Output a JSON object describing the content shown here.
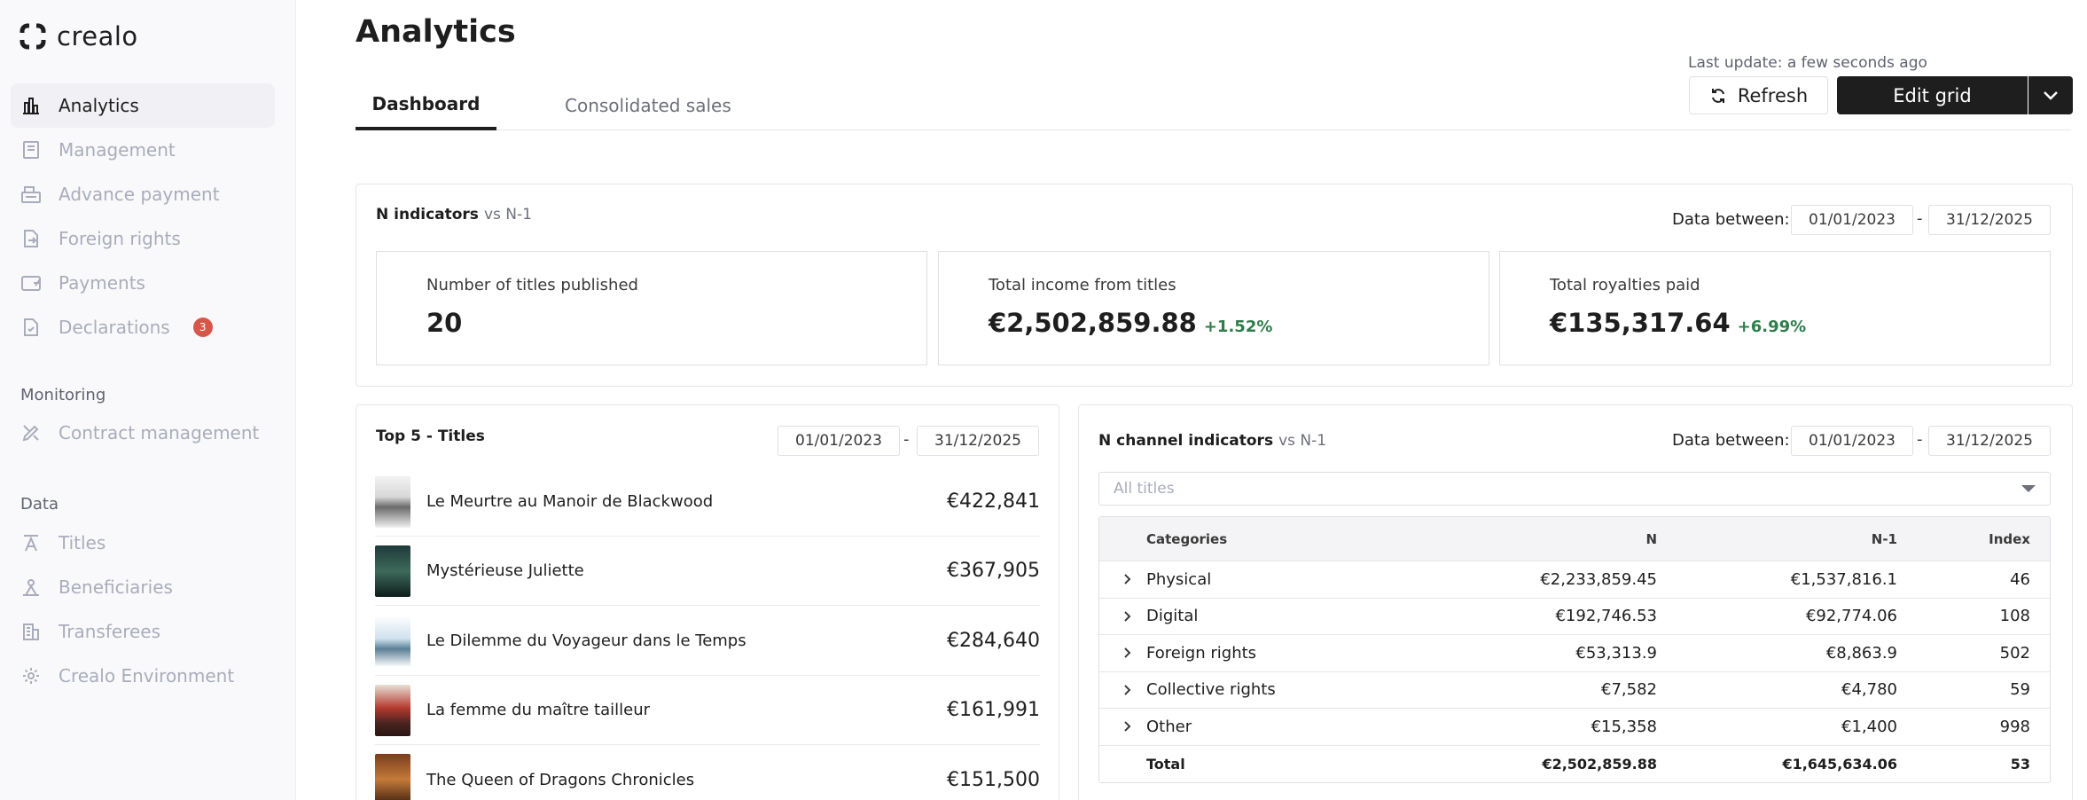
{
  "app": {
    "logo_text": "crealo"
  },
  "sidebar": {
    "items": [
      {
        "label": "Analytics",
        "icon": "bar-chart-icon",
        "active": true
      },
      {
        "label": "Management",
        "icon": "document-icon"
      },
      {
        "label": "Advance payment",
        "icon": "cash-register-icon"
      },
      {
        "label": "Foreign rights",
        "icon": "file-export-icon"
      },
      {
        "label": "Payments",
        "icon": "wallet-icon"
      },
      {
        "label": "Declarations",
        "icon": "file-check-icon",
        "badge": "3"
      }
    ],
    "monitoring_label": "Monitoring",
    "monitoring_items": [
      {
        "label": "Contract management",
        "icon": "pen-ruler-icon"
      }
    ],
    "data_label": "Data",
    "data_items": [
      {
        "label": "Titles",
        "icon": "text-icon"
      },
      {
        "label": "Beneficiaries",
        "icon": "people-icon"
      },
      {
        "label": "Transferees",
        "icon": "building-icon"
      },
      {
        "label": "Crealo Environment",
        "icon": "gear-icon"
      }
    ]
  },
  "header": {
    "title": "Analytics",
    "tabs": [
      {
        "label": "Dashboard",
        "active": true
      },
      {
        "label": "Consolidated sales"
      }
    ],
    "last_update": "Last update: a few seconds ago",
    "refresh_label": "Refresh",
    "edit_grid_label": "Edit grid"
  },
  "n_indicators": {
    "title": "N indicators",
    "subtitle": "vs N-1",
    "data_between_label": "Data between:",
    "date_from": "01/01/2023",
    "date_sep": "-",
    "date_to": "31/12/2025",
    "kpis": [
      {
        "label": "Number of titles published",
        "value": "20",
        "delta": ""
      },
      {
        "label": "Total income from titles",
        "value": "€2,502,859.88",
        "delta": "+1.52%"
      },
      {
        "label": "Total royalties paid",
        "value": "€135,317.64",
        "delta": "+6.99%"
      }
    ]
  },
  "top5": {
    "title": "Top 5 - Titles",
    "date_from": "01/01/2023",
    "date_sep": "-",
    "date_to": "31/12/2025",
    "rows": [
      {
        "title": "Le Meurtre au Manoir de Blackwood",
        "value": "€422,841"
      },
      {
        "title": "Mystérieuse Juliette",
        "value": "€367,905"
      },
      {
        "title": "Le Dilemme du Voyageur dans le Temps",
        "value": "€284,640"
      },
      {
        "title": "La femme du maître tailleur",
        "value": "€161,991"
      },
      {
        "title": "The Queen of Dragons Chronicles",
        "value": "€151,500"
      }
    ]
  },
  "channel": {
    "title": "N channel indicators",
    "subtitle": "vs N-1",
    "data_between_label": "Data between:",
    "date_from": "01/01/2023",
    "date_sep": "-",
    "date_to": "31/12/2025",
    "select_placeholder": "All titles",
    "columns": {
      "category": "Categories",
      "n": "N",
      "n1": "N-1",
      "index": "Index"
    },
    "rows": [
      {
        "category": "Physical",
        "n": "€2,233,859.45",
        "n1": "€1,537,816.1",
        "index": "46"
      },
      {
        "category": "Digital",
        "n": "€192,746.53",
        "n1": "€92,774.06",
        "index": "108"
      },
      {
        "category": "Foreign rights",
        "n": "€53,313.9",
        "n1": "€8,863.9",
        "index": "502"
      },
      {
        "category": "Collective rights",
        "n": "€7,582",
        "n1": "€4,780",
        "index": "59"
      },
      {
        "category": "Other",
        "n": "€15,358",
        "n1": "€1,400",
        "index": "998"
      }
    ],
    "total": {
      "category": "Total",
      "n": "€2,502,859.88",
      "n1": "€1,645,634.06",
      "index": "53"
    }
  }
}
